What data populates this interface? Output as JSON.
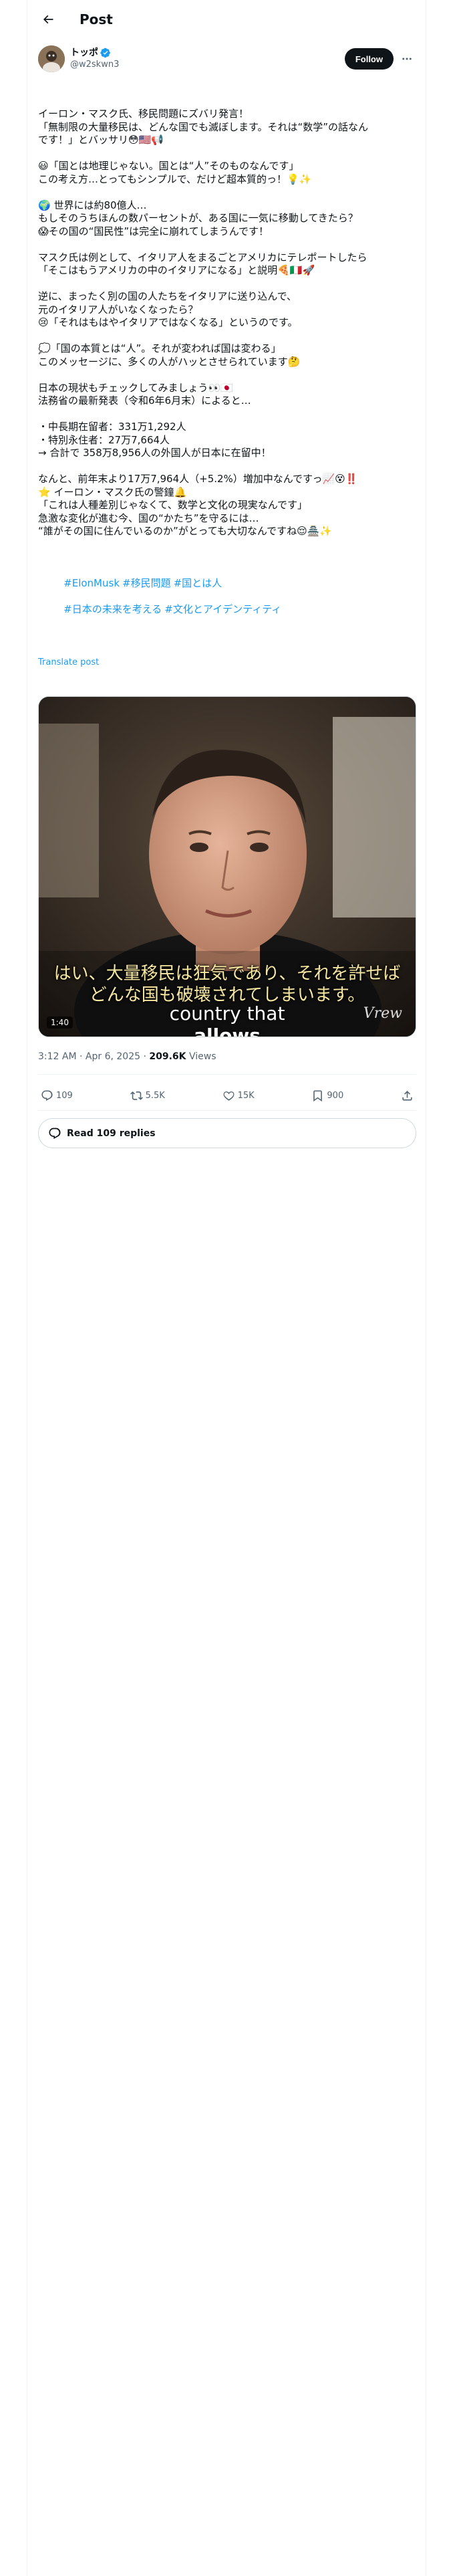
{
  "header": {
    "title": "Post"
  },
  "author": {
    "display_name": "トッポ",
    "handle": "@w2skwn3",
    "follow_label": "Follow"
  },
  "post": {
    "lines": [
      "イーロン・マスク氏、移民問題にズバリ発言！",
      "「無制限の大量移民は、どんな国でも滅ぼします。それは“数学”の話なん",
      "です！」とバッサリ😳🇺🇸📢",
      "",
      "😃「国とは地理じゃない。国とは“人”そのものなんです」",
      "この考え方…とってもシンプルで、だけど超本質的っ！💡✨",
      "",
      "🌍 世界には約80億人…",
      "もしそのうちほんの数パーセントが、ある国に一気に移動してきたら？",
      "😱その国の“国民性”は完全に崩れてしまうんです！",
      "",
      "マスク氏は例として、イタリア人をまるごとアメリカにテレポートしたら",
      "「そこはもうアメリカの中のイタリアになる」と説明🍕🇮🇹🚀",
      "",
      "逆に、まったく別の国の人たちをイタリアに送り込んで、",
      "元のイタリア人がいなくなったら？",
      "😢「それはもはやイタリアではなくなる」というのです。",
      "",
      "💭「国の本質とは“人”。それが変われば国は変わる」",
      "このメッセージに、多くの人がハッとさせられています🤔",
      "",
      "日本の現状もチェックしてみましょう👀🇯🇵",
      "法務省の最新発表（令和6年6月末）によると…",
      "",
      "・中長期在留者：331万1,292人",
      "・特別永住者：27万7,664人",
      "→ 合計で 358万8,956人の外国人が日本に在留中！",
      "",
      "なんと、前年末より17万7,964人（+5.2%）増加中なんですっ📈😵‼️",
      "⭐ イーロン・マスク氏の警鐘🔔",
      "「これは人種差別じゃなくて、数学と文化の現実なんです」",
      "急激な変化が進む今、国の“かたち”を守るには…",
      "“誰がその国に住んでいるのか”がとっても大切なんですね😌🏯✨"
    ],
    "hashtags": [
      "#ElonMusk",
      "#移民問題",
      "#国とは人",
      "#日本の未来を考える",
      "#文化とアイデンティティ"
    ],
    "translate_label": "Translate post"
  },
  "video": {
    "subtitle_line1": "はい、大量移民は狂気であり、それを許せば",
    "subtitle_line2": "どんな国も破壊されてしまいます。",
    "caption_line1": "country that",
    "caption_line2": "allows",
    "duration": "1:40",
    "watermark": "Vrew"
  },
  "meta": {
    "time": "3:12 AM",
    "date": "Apr 6, 2025",
    "views_count": "209.6K",
    "views_label": "Views"
  },
  "actions": {
    "replies": "109",
    "reposts": "5.5K",
    "likes": "15K",
    "bookmarks": "900"
  },
  "read_replies_label": "Read 109 replies",
  "colors": {
    "accent": "#1d9bf0",
    "text": "#0f1419",
    "muted": "#536471",
    "border": "#cfd9de"
  }
}
